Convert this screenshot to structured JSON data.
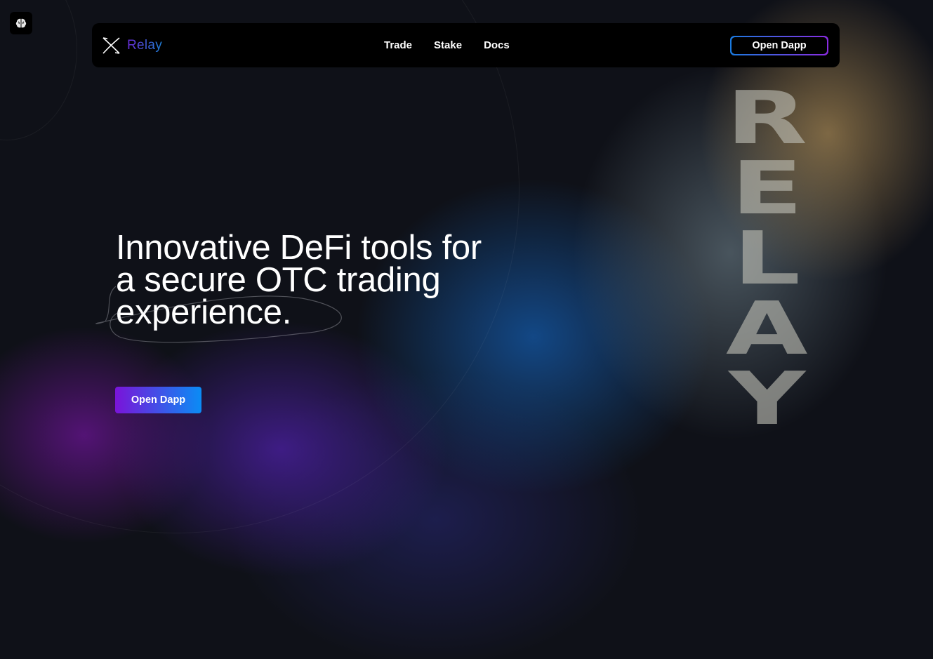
{
  "brand": {
    "name": "Relay"
  },
  "nav": {
    "links": [
      "Trade",
      "Stake",
      "Docs"
    ],
    "cta_label": "Open Dapp"
  },
  "hero": {
    "title_lines": [
      "Innovative DeFi tools for",
      "a secure OTC trading",
      "experience."
    ],
    "cta_label": "Open Dapp"
  },
  "side_word": {
    "letters": [
      "R",
      "E",
      "L",
      "A",
      "Y"
    ]
  },
  "colors": {
    "accent_purple": "#7a14d9",
    "accent_blue": "#0a8cf5",
    "background": "#0f1118"
  },
  "icons": {
    "corner_badge": "brain-icon",
    "brand_logo": "relay-x-logo-icon"
  }
}
